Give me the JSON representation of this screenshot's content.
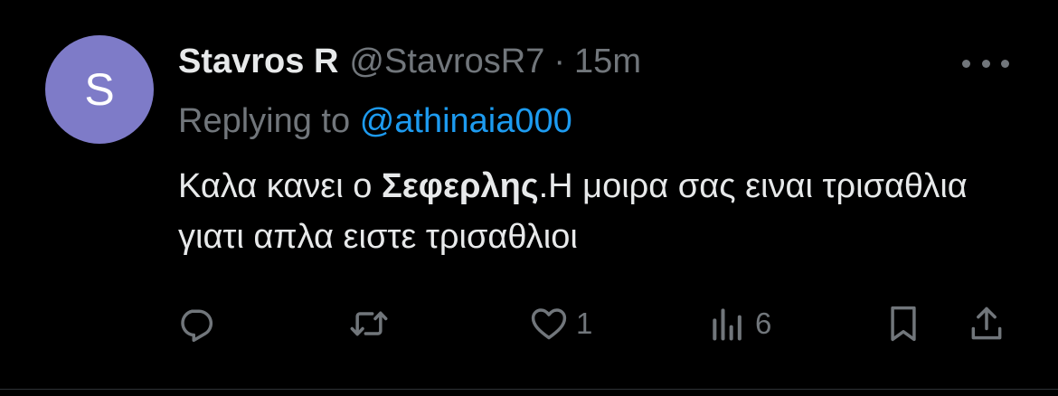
{
  "colors": {
    "background": "#000000",
    "text_primary": "#e7e9ea",
    "text_secondary": "#71767b",
    "link": "#1d9bf0",
    "avatar_bg": "#7e7bc8"
  },
  "tweet": {
    "avatar_letter": "S",
    "display_name": "Stavros R",
    "handle": "@StavrosR7",
    "separator": "·",
    "timestamp": "15m",
    "replying_prefix": "Replying to",
    "replying_to": "@athinaia000",
    "text_part1": "Καλα κανει ο ",
    "text_bold": "Σεφερλης",
    "text_part2": ".Η μοιρα σας ειναι τρισαθλια γιατι απλα ειστε τρισαθλιοι"
  },
  "actions": {
    "reply": {
      "icon": "reply-icon",
      "count": ""
    },
    "retweet": {
      "icon": "retweet-icon",
      "count": ""
    },
    "like": {
      "icon": "heart-icon",
      "count": "1"
    },
    "views": {
      "icon": "views-icon",
      "count": "6"
    },
    "bookmark": {
      "icon": "bookmark-icon"
    },
    "share": {
      "icon": "share-icon"
    },
    "more": {
      "icon": "more-icon"
    }
  }
}
